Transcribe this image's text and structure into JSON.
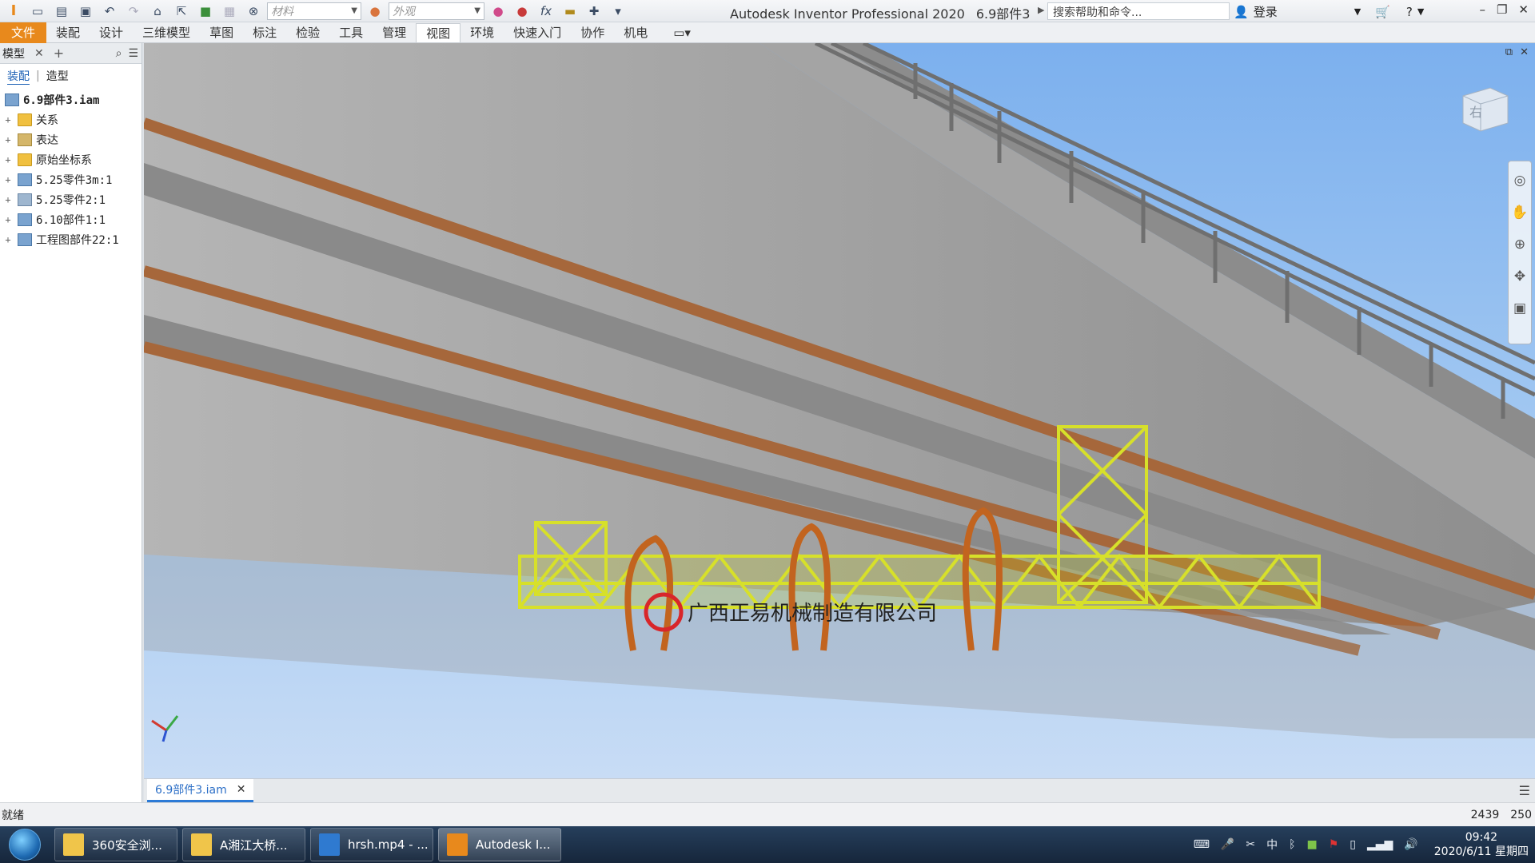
{
  "titlebar": {
    "material_placeholder": "材料",
    "appearance_placeholder": "外观",
    "app_name": "Autodesk Inventor Professional 2020",
    "document_name": "6.9部件3",
    "help_search": "搜索帮助和命令...",
    "login": "登录"
  },
  "ribbon": {
    "tabs": [
      "文件",
      "装配",
      "设计",
      "三维模型",
      "草图",
      "标注",
      "检验",
      "工具",
      "管理",
      "视图",
      "环境",
      "快速入门",
      "协作",
      "机电"
    ],
    "active_tab": "视图"
  },
  "browser": {
    "title": "模型",
    "subtabs": [
      "装配",
      "造型"
    ],
    "root": "6.9部件3.iam",
    "nodes": [
      {
        "label": "关系",
        "icon": "folder-icon"
      },
      {
        "label": "表达",
        "icon": "representations-icon"
      },
      {
        "label": "原始坐标系",
        "icon": "folder-icon"
      },
      {
        "label": "5.25零件3m:1",
        "icon": "assembly-icon"
      },
      {
        "label": "5.25零件2:1",
        "icon": "part-icon"
      },
      {
        "label": "6.10部件1:1",
        "icon": "assembly-icon"
      },
      {
        "label": "工程图部件22:1",
        "icon": "assembly-icon"
      }
    ]
  },
  "viewport": {
    "watermark_text": "广西正易机械制造有限公司",
    "viewcube_face": "右"
  },
  "document_tab": {
    "label": "6.9部件3.iam"
  },
  "status": {
    "text": "就绪",
    "count_a": "2439",
    "count_b": "250"
  },
  "taskbar": {
    "items": [
      "360安全浏...",
      "A湘江大桥...",
      "hrsh.mp4 - ...",
      "Autodesk I..."
    ],
    "time": "09:42",
    "date": "2020/6/11 星期四",
    "ime": "中"
  },
  "colors": {
    "accent_file_tab": "#e8891c",
    "active_doc_tab": "#2c7ad6",
    "sky": "#7cb0ee",
    "platform": "#d7e02a",
    "girder_stripe": "#a6673b"
  }
}
